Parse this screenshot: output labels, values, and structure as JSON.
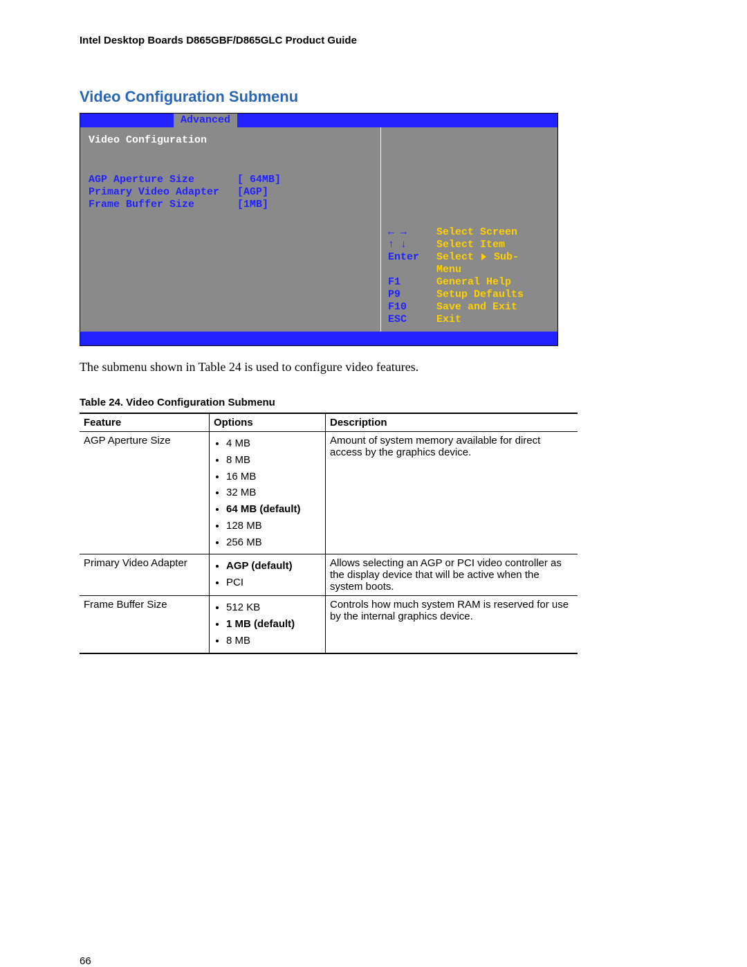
{
  "doc_header": "Intel Desktop Boards D865GBF/D865GLC Product Guide",
  "section_title": "Video Configuration Submenu",
  "bios": {
    "active_tab": "Advanced",
    "submenu_title": "Video Configuration",
    "settings": [
      {
        "label": "AGP Aperture Size",
        "value": "[ 64MB]"
      },
      {
        "label": "Primary Video Adapter",
        "value": "[AGP]"
      },
      {
        "label": "Frame Buffer Size",
        "value": "[1MB]"
      }
    ],
    "help": [
      {
        "key": "← →",
        "action": "Select Screen",
        "arrow": false
      },
      {
        "key": "↑ ↓",
        "action": "Select Item",
        "arrow": false
      },
      {
        "key": "Enter",
        "action_pre": "Select ",
        "action_post": " Sub-",
        "arrow": true
      },
      {
        "key": "",
        "action": "Menu",
        "arrow": false
      },
      {
        "key": "F1",
        "action": "General Help",
        "arrow": false
      },
      {
        "key": "P9",
        "action": "Setup Defaults",
        "arrow": false
      },
      {
        "key": "F10",
        "action": "Save and Exit",
        "arrow": false
      },
      {
        "key": "ESC",
        "action": "Exit",
        "arrow": false
      }
    ]
  },
  "caption": "The submenu shown in Table 24 is used to configure video features.",
  "table_title": "Table 24.   Video Configuration Submenu",
  "table": {
    "headers": [
      "Feature",
      "Options",
      "Description"
    ],
    "rows": [
      {
        "feature": "AGP Aperture Size",
        "options": [
          {
            "text": "4 MB",
            "bold": false
          },
          {
            "text": "8 MB",
            "bold": false
          },
          {
            "text": "16 MB",
            "bold": false
          },
          {
            "text": "32 MB",
            "bold": false
          },
          {
            "text": "64 MB (default)",
            "bold": true
          },
          {
            "text": "128 MB",
            "bold": false
          },
          {
            "text": "256 MB",
            "bold": false
          }
        ],
        "description": "Amount of system memory available for direct access by the graphics device."
      },
      {
        "feature": "Primary Video Adapter",
        "options": [
          {
            "text": "AGP (default)",
            "bold": true
          },
          {
            "text": "PCI",
            "bold": false
          }
        ],
        "description": "Allows selecting an AGP or PCI video controller as the display device that will be active when the system boots."
      },
      {
        "feature": "Frame Buffer Size",
        "options": [
          {
            "text": "512 KB",
            "bold": false
          },
          {
            "text": "1 MB (default)",
            "bold": true
          },
          {
            "text": "8 MB",
            "bold": false
          }
        ],
        "description": "Controls how much system RAM is reserved for use by the internal graphics device."
      }
    ]
  },
  "page_number": "66"
}
